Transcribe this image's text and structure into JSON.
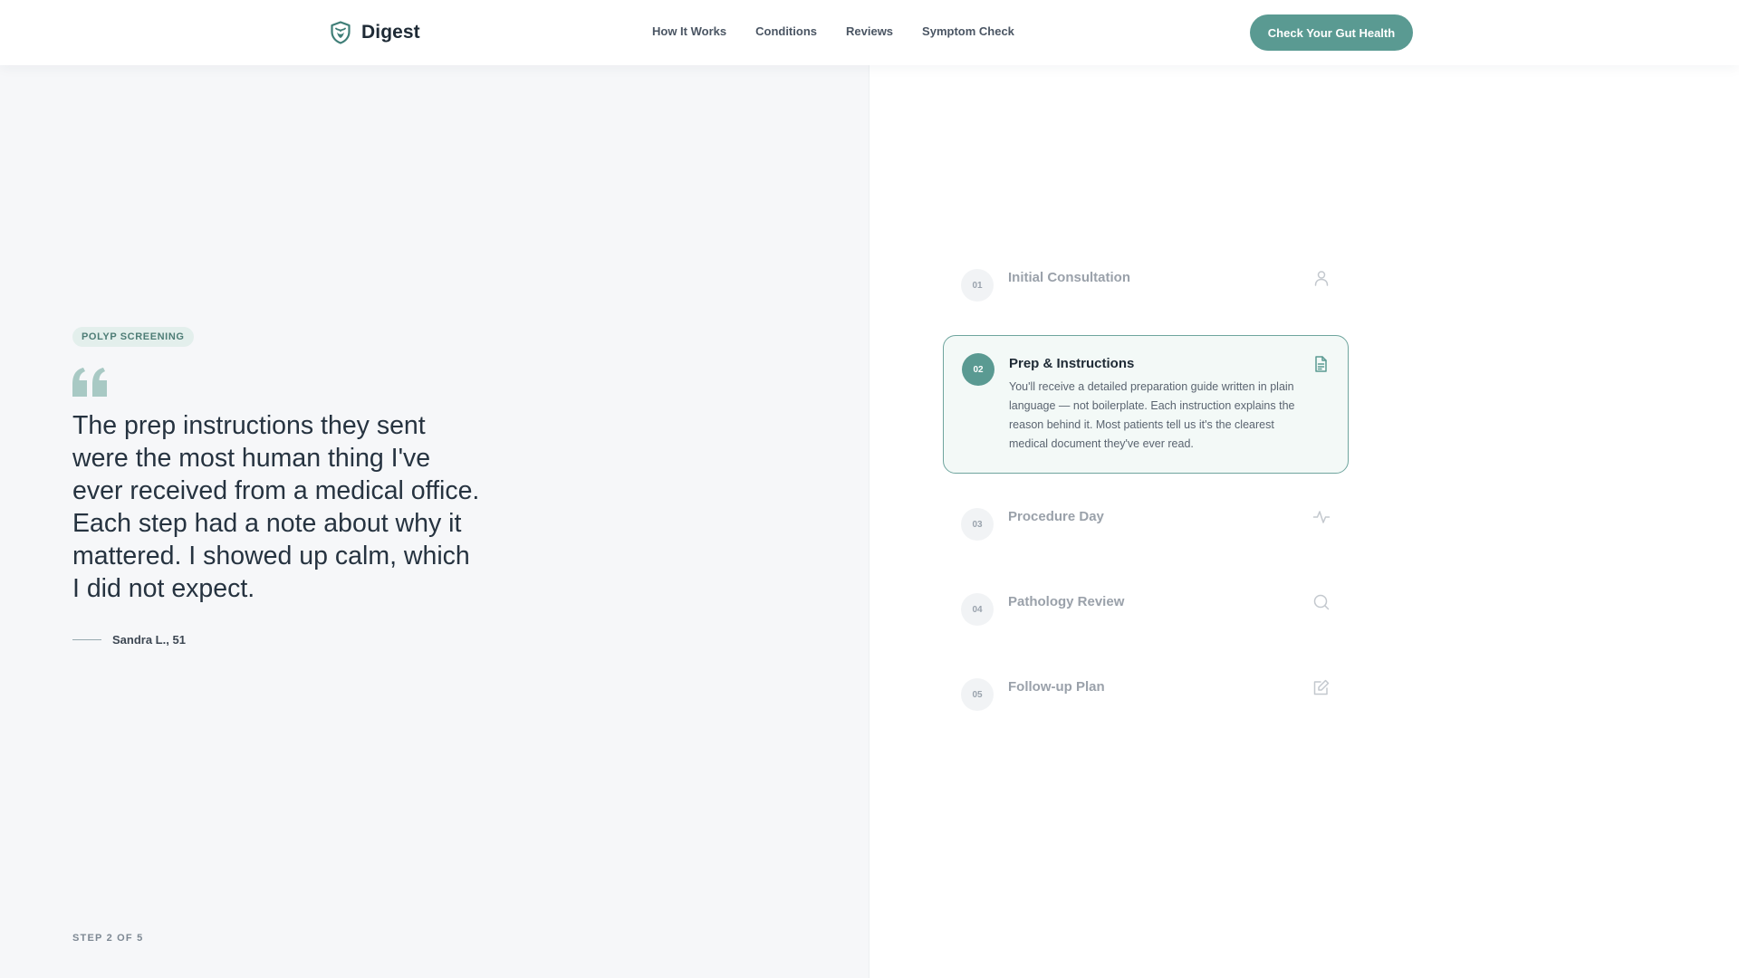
{
  "header": {
    "brand": "Digest",
    "nav": [
      "How It Works",
      "Conditions",
      "Reviews",
      "Symptom Check"
    ],
    "cta": "Check Your Gut Health"
  },
  "testimonial": {
    "tag": "POLYP SCREENING",
    "quote": "The prep instructions they sent were the most human thing I've ever received from a medical office. Each step had a note about why it mattered. I showed up calm, which I did not expect.",
    "author": "Sandra L., 51",
    "step_indicator": "STEP 2 OF 5"
  },
  "steps": [
    {
      "number": "01",
      "title": "Initial Consultation",
      "icon": "user-icon",
      "active": false
    },
    {
      "number": "02",
      "title": "Prep & Instructions",
      "icon": "document-icon",
      "active": true,
      "description": "You'll receive a detailed preparation guide written in plain language — not boilerplate. Each instruction explains the reason behind it. Most patients tell us it's the clearest medical document they've ever read."
    },
    {
      "number": "03",
      "title": "Procedure Day",
      "icon": "activity-icon",
      "active": false
    },
    {
      "number": "04",
      "title": "Pathology Review",
      "icon": "search-icon",
      "active": false
    },
    {
      "number": "05",
      "title": "Follow-up Plan",
      "icon": "edit-icon",
      "active": false
    }
  ],
  "colors": {
    "accent": "#5a9a92",
    "active_step_bg": "#f3f9f7",
    "left_panel_bg": "#f6f7f9"
  }
}
